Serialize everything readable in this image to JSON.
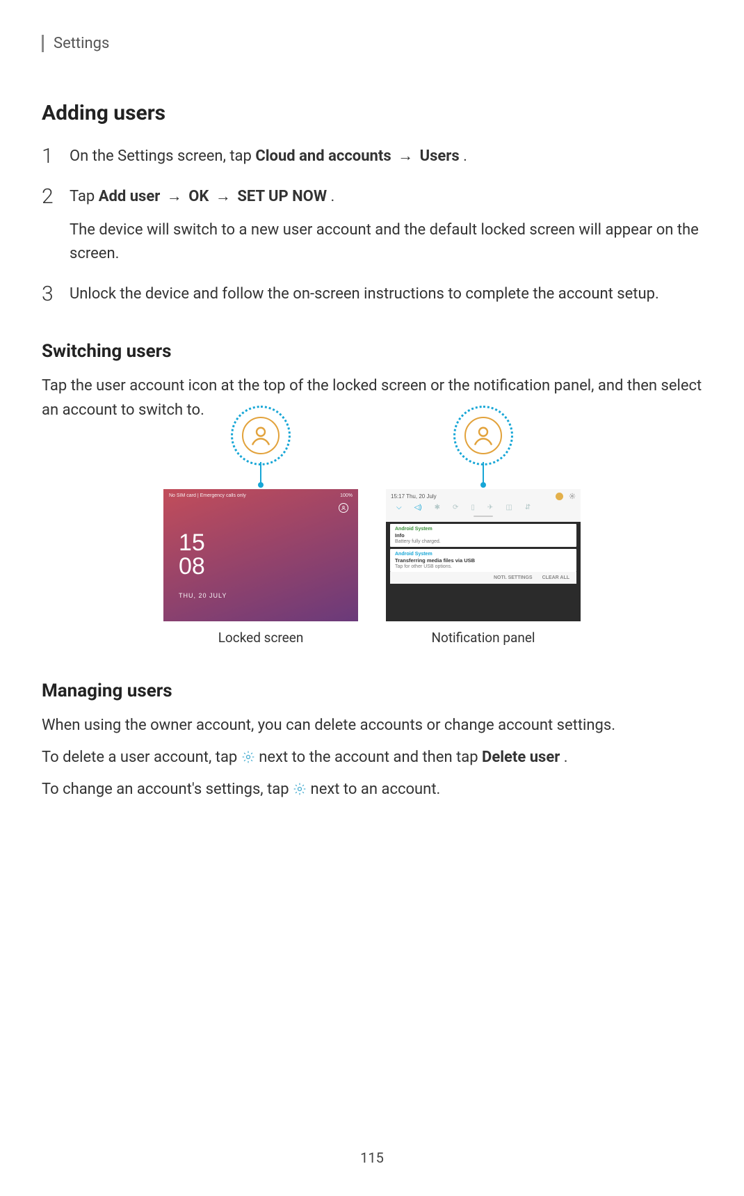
{
  "header": {
    "title": "Settings"
  },
  "h_adding": "Adding users",
  "steps": [
    {
      "num": "1",
      "pre": "On the Settings screen, tap ",
      "bold1": "Cloud and accounts",
      "mid": " → ",
      "bold2": "Users",
      "post": "."
    },
    {
      "num": "2",
      "pre": "Tap ",
      "bold1": "Add user",
      "mid1": " → ",
      "bold2": "OK",
      "mid2": " → ",
      "bold3": "SET UP NOW",
      "post": ".",
      "extra": "The device will switch to a new user account and the default locked screen will appear on the screen."
    },
    {
      "num": "3",
      "text": "Unlock the device and follow the on-screen instructions to complete the account setup."
    }
  ],
  "h_switching": "Switching users",
  "switching_para": "Tap the user account icon at the top of the locked screen or the notification panel, and then select an account to switch to.",
  "captions": {
    "locked": "Locked screen",
    "notif": "Notification panel"
  },
  "locked": {
    "status_left": "No SIM card | Emergency calls only",
    "status_right": "100%",
    "hour": "15",
    "minute": "08",
    "date": "THU, 20 JULY"
  },
  "notif": {
    "time_date": "15:17  Thu, 20 July",
    "card1": {
      "src": "Android System",
      "title": "Info",
      "sub": "Battery fully charged."
    },
    "card2": {
      "src": "Android System",
      "title": "Transferring media files via USB",
      "sub": "Tap for other USB options."
    },
    "actions": {
      "settings": "NOTI. SETTINGS",
      "clear": "CLEAR ALL"
    }
  },
  "h_managing": "Managing users",
  "managing_p1": "When using the owner account, you can delete accounts or change account settings.",
  "managing_p2a": "To delete a user account, tap ",
  "managing_p2b": " next to the account and then tap ",
  "managing_p2c": "Delete user",
  "managing_p2d": ".",
  "managing_p3a": "To change an account's settings, tap ",
  "managing_p3b": " next to an account.",
  "page_number": "115"
}
